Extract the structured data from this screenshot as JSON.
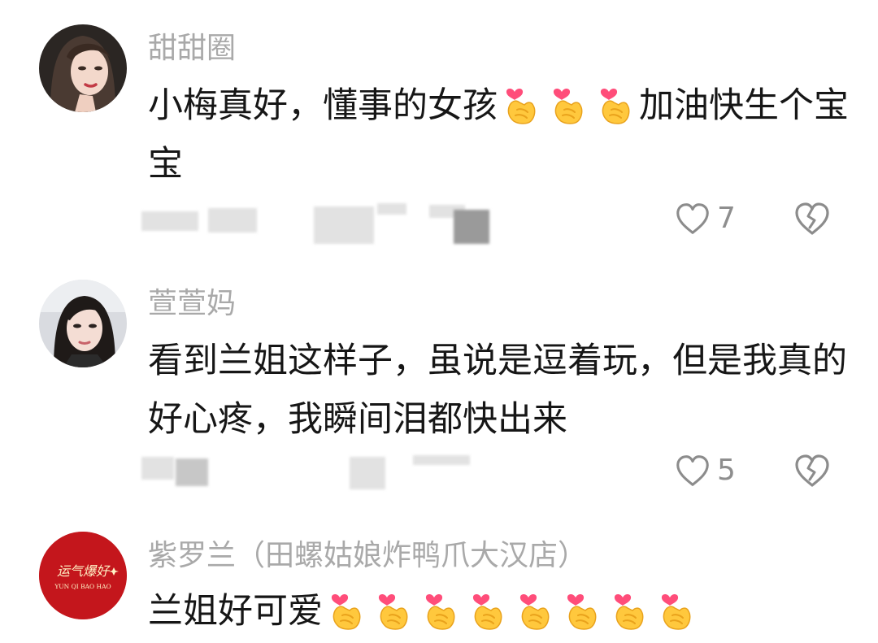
{
  "comments": [
    {
      "username": "甜甜圈",
      "text_before": "小梅真好，懂事的女孩",
      "heart_emoji_count": 3,
      "text_after": "加油快生个宝宝",
      "reply_label": "回复",
      "like_count": "7",
      "icons": {
        "like": "heart-outline-icon",
        "dislike": "broken-heart-icon",
        "emoji": "finger-heart-emoji"
      }
    },
    {
      "username": "萱萱妈",
      "text": "看到兰姐这样子，虽说是逗着玩，但是我真的好心疼，我瞬间泪都快出来",
      "like_count": "5",
      "icons": {
        "like": "heart-outline-icon",
        "dislike": "broken-heart-icon"
      }
    },
    {
      "username": "紫罗兰（田螺姑娘炸鸭爪大汉店）",
      "text_before": "兰姐好可爱",
      "heart_emoji_count": 8,
      "avatar_logo_line1": "运气爆好",
      "avatar_logo_line2": "YUN QI BAO HAO",
      "avatar_color": "#c4161c",
      "icons": {
        "emoji": "finger-heart-emoji"
      }
    }
  ]
}
